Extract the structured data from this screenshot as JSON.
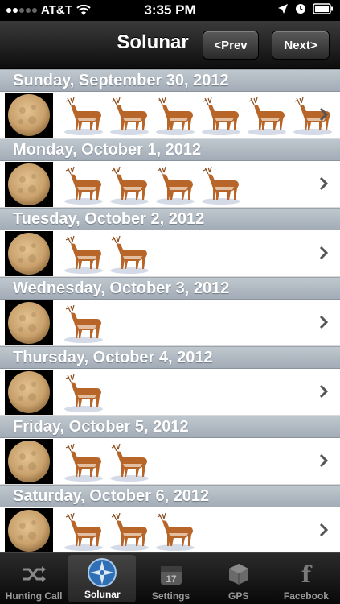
{
  "status": {
    "carrier": "AT&T",
    "time": "3:35 PM"
  },
  "nav": {
    "title": "Solunar",
    "prev_label": "<Prev",
    "next_label": "Next>"
  },
  "days": [
    {
      "date": "Sunday, September 30, 2012",
      "rating": 6,
      "moon_phase": "full"
    },
    {
      "date": "Monday, October 1, 2012",
      "rating": 4,
      "moon_phase": "full"
    },
    {
      "date": "Tuesday, October 2, 2012",
      "rating": 2,
      "moon_phase": "full"
    },
    {
      "date": "Wednesday, October 3, 2012",
      "rating": 1,
      "moon_phase": "full"
    },
    {
      "date": "Thursday, October 4, 2012",
      "rating": 1,
      "moon_phase": "waning-gibbous"
    },
    {
      "date": "Friday, October 5, 2012",
      "rating": 2,
      "moon_phase": "waning-gibbous"
    },
    {
      "date": "Saturday, October 6, 2012",
      "rating": 3,
      "moon_phase": "waning-gibbous"
    }
  ],
  "tabs": [
    {
      "label": "Hunting Call",
      "icon": "shuffle-icon",
      "active": false
    },
    {
      "label": "Solunar",
      "icon": "compass-icon",
      "active": true
    },
    {
      "label": "Settings",
      "icon": "calendar-icon",
      "active": false,
      "icon_text": "17"
    },
    {
      "label": "GPS",
      "icon": "cube-icon",
      "active": false
    },
    {
      "label": "Facebook",
      "icon": "facebook-icon",
      "active": false,
      "icon_text": "f"
    }
  ],
  "colors": {
    "section_header": "#a9b3bd",
    "deer_body": "#b8652a",
    "moon": "#caa574"
  }
}
